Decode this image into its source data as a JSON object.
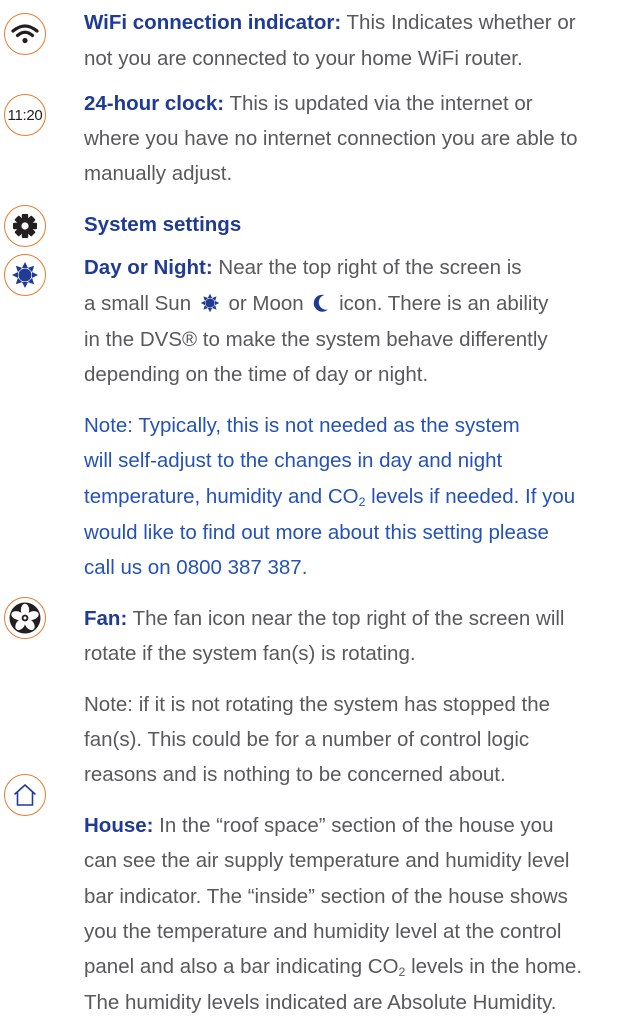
{
  "colors": {
    "icon_border": "#ea7b2f",
    "heading": "#1f3b93",
    "note": "#2452b8",
    "body": "#58595b"
  },
  "icons": [
    "wifi-icon",
    "clock-icon",
    "gear-icon",
    "sun-icon",
    "fan-icon",
    "house-icon"
  ],
  "clock_icon_text": "11:20",
  "wifi": {
    "label": "WiFi connection indicator:",
    "line1": " This Indicates whether or",
    "line2": "not you are connected to your home WiFi router."
  },
  "clock": {
    "label": "24-hour clock:",
    "line1": " This is updated via the internet or",
    "line2": "where you have no internet connection you are able to",
    "line3": "manually adjust."
  },
  "settings": {
    "heading": "System settings"
  },
  "daynight": {
    "label": "Day or Night:",
    "line1": " Near the top right of the screen is",
    "line2_a": "a small Sun ",
    "line2_b": " or Moon ",
    "line2_c": " icon. There is an ability",
    "line3": "in the DVS® to make the system behave differently",
    "line4": "depending on the time of day or night.",
    "note1": "Note: Typically, this is not needed as the system",
    "note2": "will self-adjust to the changes in day and night",
    "note3_a": "temperature, humidity and CO",
    "note3_sub": "2",
    "note3_b": " levels if needed. If you",
    "note4": "would like to find out more about this setting please",
    "note5": "call us on 0800 387 387."
  },
  "fan": {
    "label": "Fan:",
    "line1": " The fan icon near the top right of the screen will",
    "line2": "rotate if the system fan(s) is rotating.",
    "note1": "Note: if it is not rotating the system has stopped the",
    "note2": "fan(s). This could be for a number of control logic",
    "note3": "reasons and is nothing to be concerned about."
  },
  "house": {
    "label": "House:",
    "line1": " In the “roof space” section of the house you",
    "line2": "can see the air supply temperature and humidity level",
    "line3": "bar indicator. The “inside” section of the house shows",
    "line4": "you the temperature and humidity level at the control",
    "line5_a": "panel and also a bar indicating CO",
    "line5_sub": "2",
    "line5_b": " levels in the home.",
    "line6": "The humidity levels indicated are Absolute Humidity."
  }
}
